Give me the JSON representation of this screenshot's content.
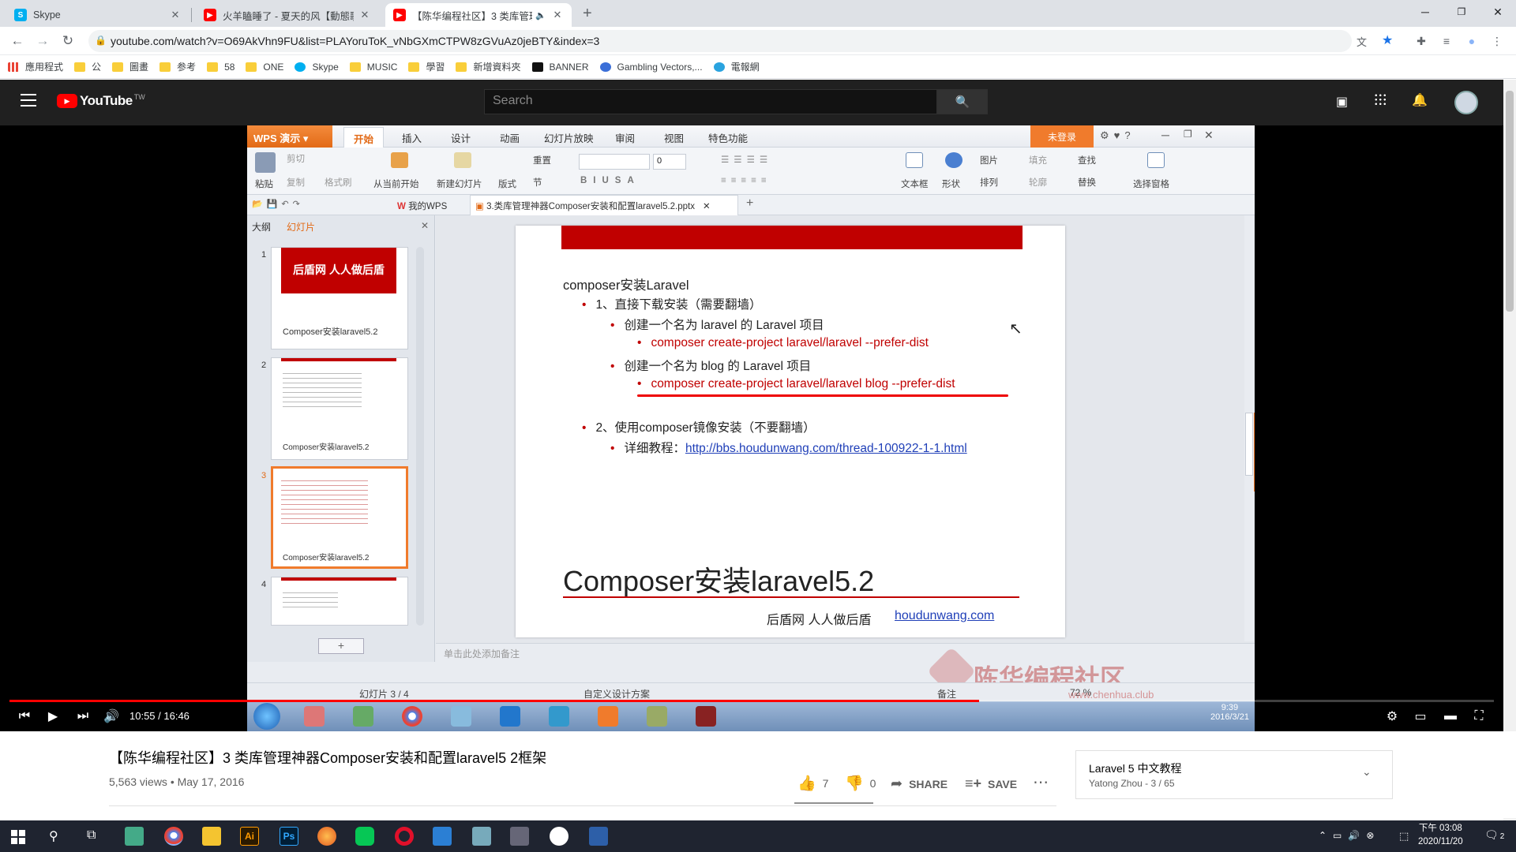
{
  "chrome": {
    "tabs": [
      {
        "title": "Skype",
        "icon": "skype-icon"
      },
      {
        "title": "火羊瞌睡了 - 夏天的风【動態歌詞",
        "icon": "youtube-icon"
      },
      {
        "title": "【陈华编程社区】3 类库管理",
        "icon": "youtube-icon"
      }
    ],
    "url": "youtube.com/watch?v=O69AkVhn9FU&list=PLAYoruToK_vNbGXmCTPW8zGVuAz0jeBTY&index=3",
    "bookmarks": [
      "應用程式",
      "公",
      "圖畫",
      "参考",
      "58",
      "ONE",
      "Skype",
      "MUSIC",
      "學習",
      "新增資料夾",
      "BANNER",
      "Gambling Vectors,...",
      "電報網"
    ]
  },
  "youtube": {
    "logo": "YouTube",
    "region": "TW",
    "search_placeholder": "Search",
    "time": "10:55 / 16:46",
    "progress": 0.653,
    "title": "【陈华编程社区】3 类库管理神器Composer安装和配置laravel5 2框架",
    "meta": "5,563 views • May 17, 2016",
    "likes": "7",
    "dislikes": "0",
    "share": "SHARE",
    "save": "SAVE",
    "playlist_title": "Laravel 5 中文教程",
    "playlist_meta": "Yatong Zhou - 3 / 65"
  },
  "wps": {
    "app_name": "WPS 演示",
    "menus": [
      "开始",
      "插入",
      "设计",
      "动画",
      "幻灯片放映",
      "审阅",
      "视图",
      "特色功能"
    ],
    "login": "未登录",
    "ribbon": {
      "paste": "粘贴",
      "cut": "剪切",
      "copy": "复制",
      "format": "格式刷",
      "from_current": "从当前开始",
      "new_slide": "新建幻灯片",
      "layout": "版式",
      "reset": "重置",
      "section": "节",
      "font_size": "0",
      "textbox": "文本框",
      "shape": "形状",
      "arrange": "排列",
      "picture": "图片",
      "fill": "填充",
      "outline": "轮廓",
      "find": "查找",
      "replace": "替换",
      "select_pane": "选择窗格"
    },
    "doc_tabs": {
      "my_wps": "我的WPS",
      "file": "3.类库管理神器Composer安装和配置laravel5.2.pptx"
    },
    "left_pane": {
      "outline": "大纲",
      "slides": "幻灯片"
    },
    "thumbnails": [
      {
        "num": "1",
        "banner": "后盾网 人人做后盾",
        "caption": "Composer安装laravel5.2"
      },
      {
        "num": "2",
        "caption": "Composer安装laravel5.2"
      },
      {
        "num": "3",
        "caption": "Composer安装laravel5.2"
      },
      {
        "num": "4",
        "caption": ""
      }
    ],
    "notes_placeholder": "单击此处添加备注",
    "status": {
      "slide": "幻灯片 3 / 4",
      "design": "自定义设计方案",
      "notes": "备注",
      "zoom": "72 %"
    },
    "watermark": "陈华编程社区",
    "watermark_url": "www.chenhua.club"
  },
  "slide": {
    "heading": "composer安装Laravel",
    "l1": "1、直接下载安装（需要翻墙）",
    "l2a": "创建一个名为 laravel 的 Laravel 项目",
    "l3a": "composer create-project laravel/laravel --prefer-dist",
    "l2b": "创建一个名为 blog 的 Laravel 项目",
    "l3b": "composer create-project laravel/laravel blog --prefer-dist",
    "l4": "2、使用composer镜像安装（不要翻墙）",
    "l5_label": "详细教程：",
    "l5_link": "http://bbs.houdunwang.com/thread-100922-1-1.html",
    "footer_title": "Composer安装laravel5.2",
    "footer_brand": "后盾网 人人做后盾",
    "footer_link": "houdunwang.com"
  },
  "old_taskbar": {
    "clock_time": "9:39",
    "clock_date": "2016/3/21"
  },
  "win10": {
    "time": "下午 03:08",
    "date": "2020/11/20",
    "notify_count": "2"
  }
}
